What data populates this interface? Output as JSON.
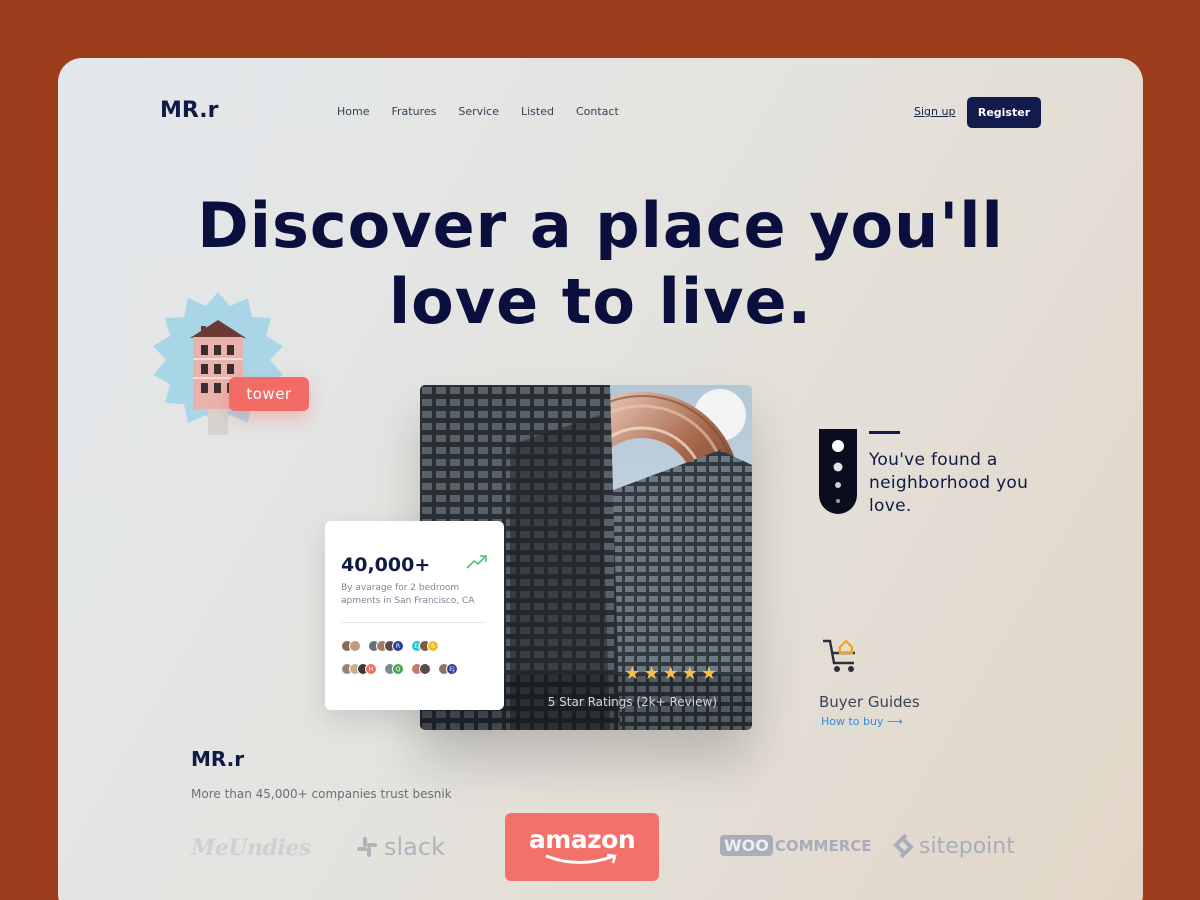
{
  "logo": "MR.r",
  "nav": {
    "items": [
      "Home",
      "Fratures",
      "Service",
      "Listed",
      "Contact"
    ]
  },
  "auth": {
    "signup": "Sign up",
    "register": "Register"
  },
  "hero": {
    "line1": "Discover a place you'll",
    "line2": "love to live."
  },
  "tag": "tower",
  "stats": {
    "value": "40,000+",
    "description": "By avarage for 2 bedroom apments in San Francisco, CA",
    "avatar_initials": [
      "R",
      "EJ",
      "S",
      "H",
      "Q",
      "EJ"
    ]
  },
  "rating": {
    "stars": 5,
    "star_glyph": "★",
    "text": "5 Star Ratings (2k+ Review)"
  },
  "neighborhood": {
    "text": "You've found a neighborhood you love."
  },
  "buyer": {
    "title": "Buyer Guides",
    "link": "How to buy ⟶"
  },
  "trust": {
    "logo": "MR.r",
    "text": "More than 45,000+ companies trust besnik",
    "brands": {
      "meundies": "MeUndies",
      "slack": "slack",
      "amazon": "amazon",
      "woo_box": "WOO",
      "woo_text": "COMMERCE",
      "sitepoint": "sitepoint"
    }
  },
  "colors": {
    "brand": "#131b4d",
    "accent": "#f26b64",
    "background": "#9e3d1b",
    "link": "#2f8de0"
  }
}
